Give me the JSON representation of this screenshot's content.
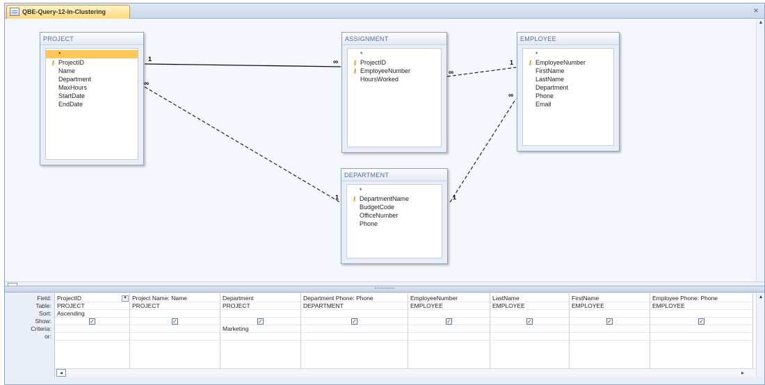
{
  "tab": {
    "title": "QBE-Query-12-In-Clustering"
  },
  "window": {
    "close_glyph": "×"
  },
  "tables": {
    "project": {
      "title": "PROJECT",
      "fields": [
        {
          "label": "*",
          "key": false,
          "selected": true
        },
        {
          "label": "ProjectID",
          "key": true
        },
        {
          "label": "Name",
          "key": false
        },
        {
          "label": "Department",
          "key": false
        },
        {
          "label": "MaxHours",
          "key": false
        },
        {
          "label": "StartDate",
          "key": false
        },
        {
          "label": "EndDate",
          "key": false
        }
      ]
    },
    "assignment": {
      "title": "ASSIGNMENT",
      "fields": [
        {
          "label": "*",
          "key": false
        },
        {
          "label": "ProjectID",
          "key": true
        },
        {
          "label": "EmployeeNumber",
          "key": true
        },
        {
          "label": "HoursWorked",
          "key": false
        }
      ]
    },
    "employee": {
      "title": "EMPLOYEE",
      "fields": [
        {
          "label": "*",
          "key": false
        },
        {
          "label": "EmployeeNumber",
          "key": true
        },
        {
          "label": "FirstName",
          "key": false
        },
        {
          "label": "LastName",
          "key": false
        },
        {
          "label": "Department",
          "key": false
        },
        {
          "label": "Phone",
          "key": false
        },
        {
          "label": "Email",
          "key": false
        }
      ]
    },
    "department": {
      "title": "DEPARTMENT",
      "fields": [
        {
          "label": "*",
          "key": false
        },
        {
          "label": "DepartmentName",
          "key": true
        },
        {
          "label": "BudgetCode",
          "key": false
        },
        {
          "label": "OfficeNumber",
          "key": false
        },
        {
          "label": "Phone",
          "key": false
        }
      ]
    }
  },
  "relationships": {
    "one": "1",
    "many": "∞"
  },
  "grid": {
    "row_labels": [
      "Field:",
      "Table:",
      "Sort:",
      "Show:",
      "Criteria:",
      "or:"
    ],
    "columns": [
      {
        "field": "ProjectID",
        "table": "PROJECT",
        "sort": "Ascending",
        "show": true,
        "criteria": "",
        "dropdown": true
      },
      {
        "field": "Project Name: Name",
        "table": "PROJECT",
        "sort": "",
        "show": true,
        "criteria": ""
      },
      {
        "field": "Department",
        "table": "PROJECT",
        "sort": "",
        "show": true,
        "criteria": "Marketing"
      },
      {
        "field": "Department Phone: Phone",
        "table": "DEPARTMENT",
        "sort": "",
        "show": true,
        "criteria": ""
      },
      {
        "field": "EmployeeNumber",
        "table": "EMPLOYEE",
        "sort": "",
        "show": true,
        "criteria": ""
      },
      {
        "field": "LastName",
        "table": "EMPLOYEE",
        "sort": "",
        "show": true,
        "criteria": ""
      },
      {
        "field": "FirstName",
        "table": "EMPLOYEE",
        "sort": "",
        "show": true,
        "criteria": ""
      },
      {
        "field": "Employee Phone: Phone",
        "table": "EMPLOYEE",
        "sort": "",
        "show": true,
        "criteria": ""
      }
    ],
    "check_glyph": "☑"
  },
  "icons": {
    "key": "key-icon",
    "close": "close-icon",
    "dropdown": "chevron-down-icon"
  }
}
